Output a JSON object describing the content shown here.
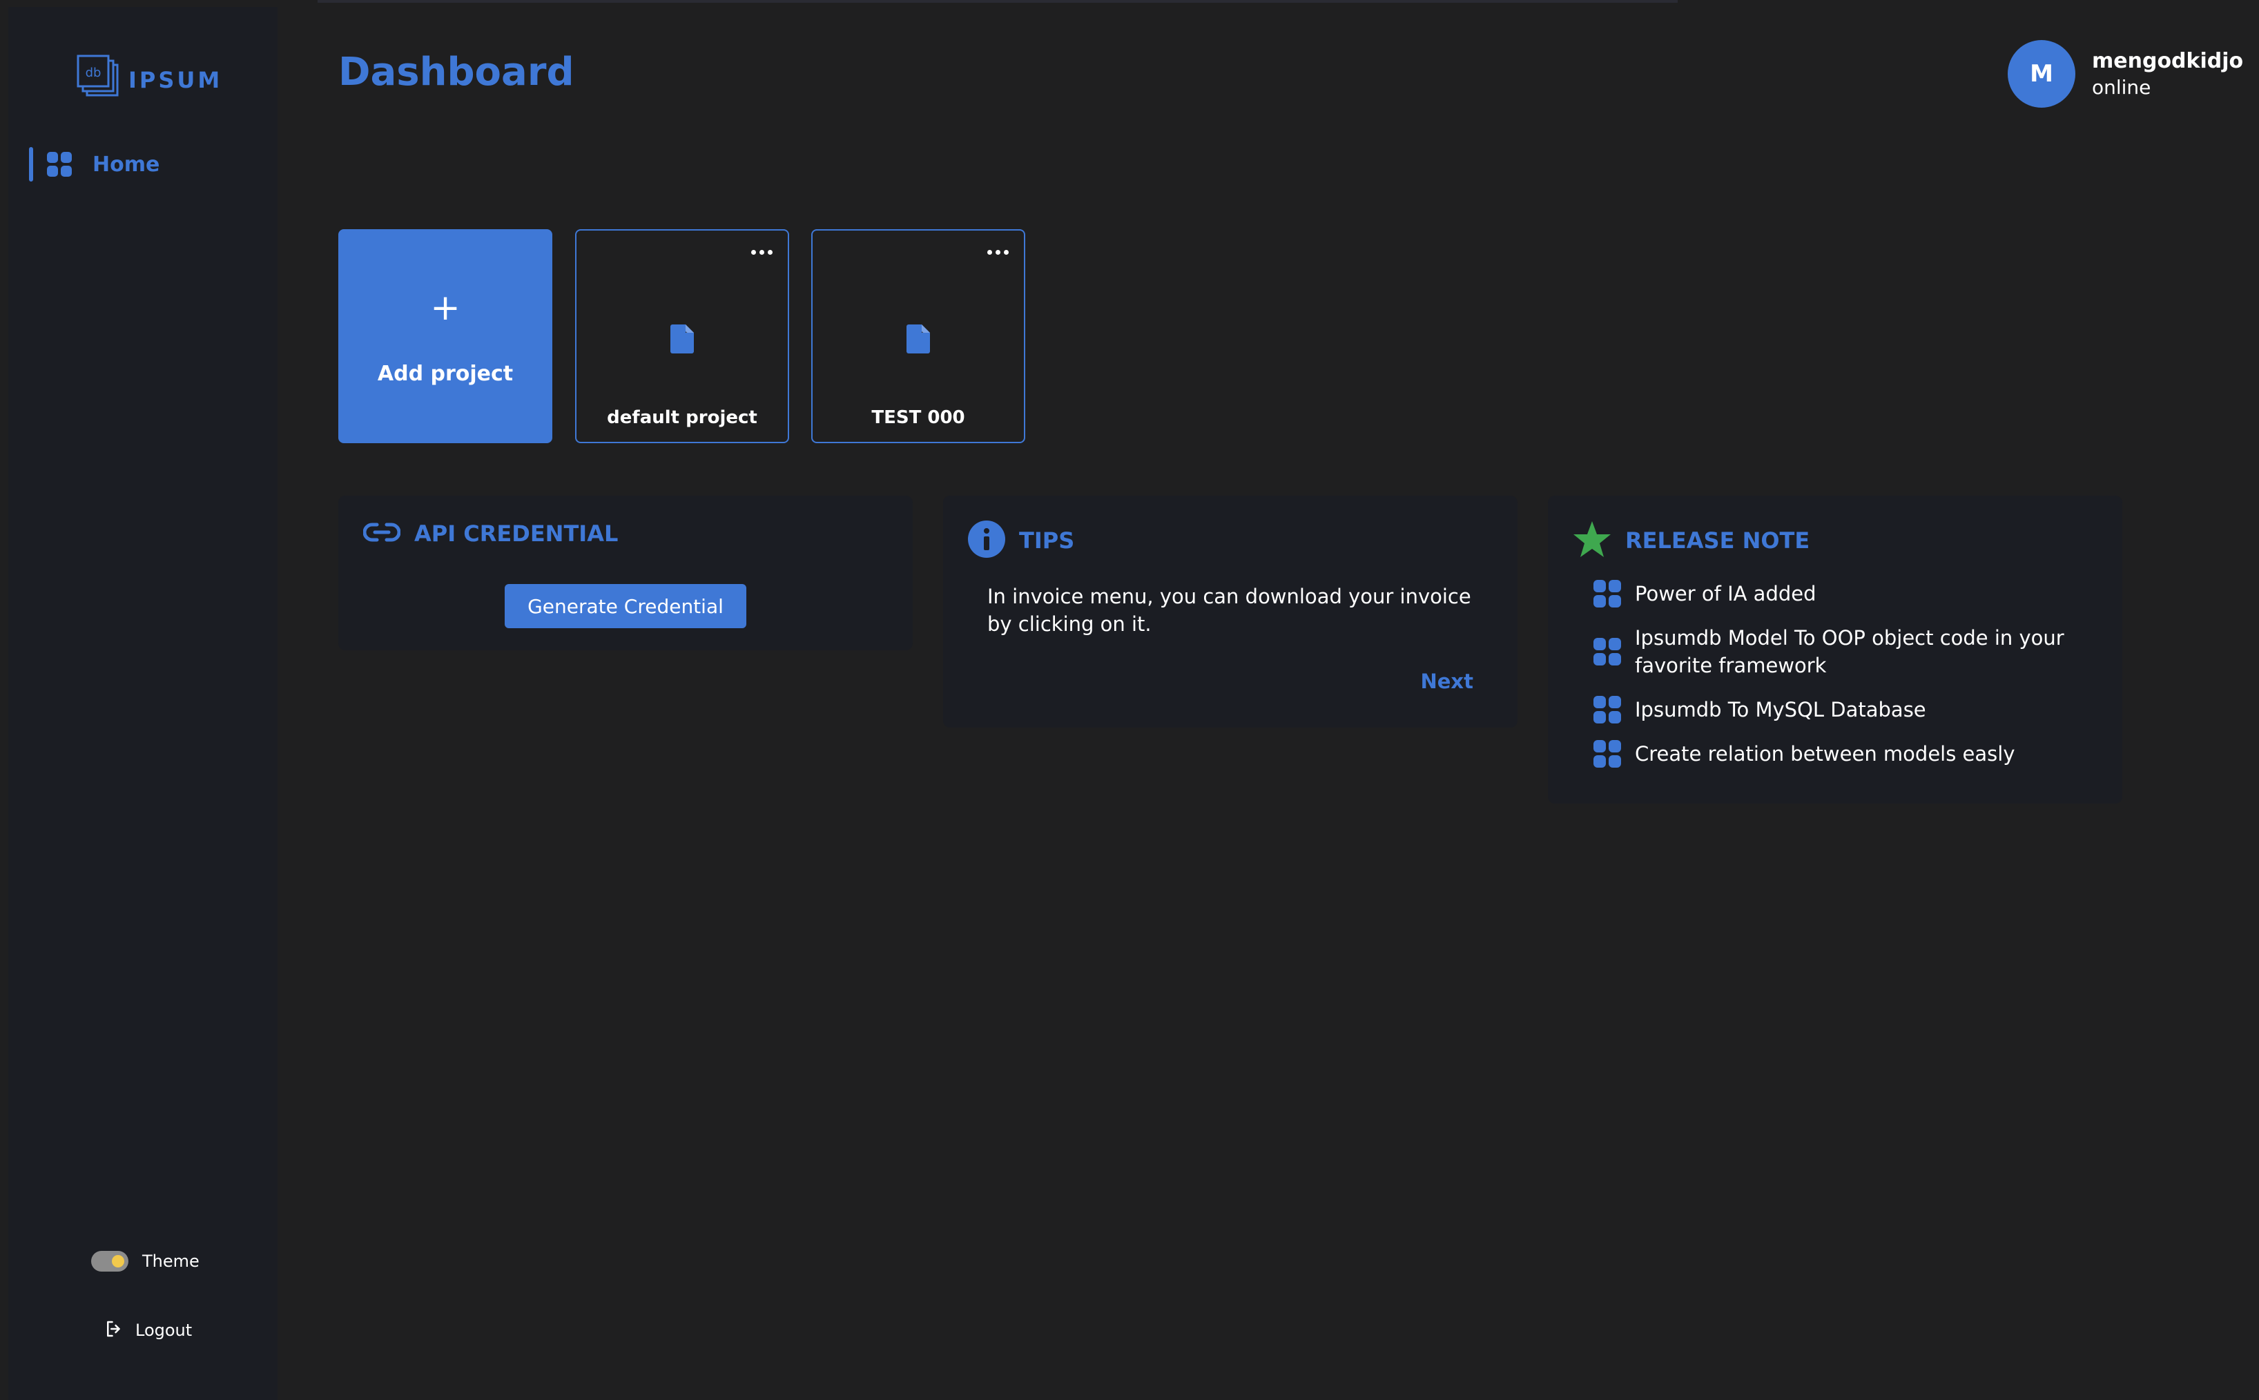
{
  "brand": {
    "logo_text": "IPSUM",
    "logo_mark": "db"
  },
  "sidebar": {
    "items": [
      {
        "label": "Home",
        "icon": "grid-icon",
        "active": true
      }
    ],
    "theme_label": "Theme",
    "logout_label": "Logout"
  },
  "header": {
    "title": "Dashboard"
  },
  "user": {
    "initial": "M",
    "name": "mengodkidjo",
    "status": "online"
  },
  "projects": {
    "add_label": "Add project",
    "add_icon": "+",
    "items": [
      {
        "name": "default project"
      },
      {
        "name": "TEST 000"
      }
    ]
  },
  "api": {
    "title": "API CREDENTIAL",
    "button_label": "Generate Credential"
  },
  "tips": {
    "title": "TIPS",
    "text": "In invoice menu, you can download your invoice by clicking on it.",
    "next_label": "Next"
  },
  "release": {
    "title": "RELEASE NOTE",
    "items": [
      "Power of IA added",
      "Ipsumdb Model To OOP object code in your favorite framework",
      "Ipsumdb To MySQL Database",
      "Create relation between models easly"
    ]
  },
  "colors": {
    "accent": "#3f78d6",
    "background": "#1f1f20",
    "sidebar": "#1b1d23",
    "star": "#3fa84f"
  }
}
